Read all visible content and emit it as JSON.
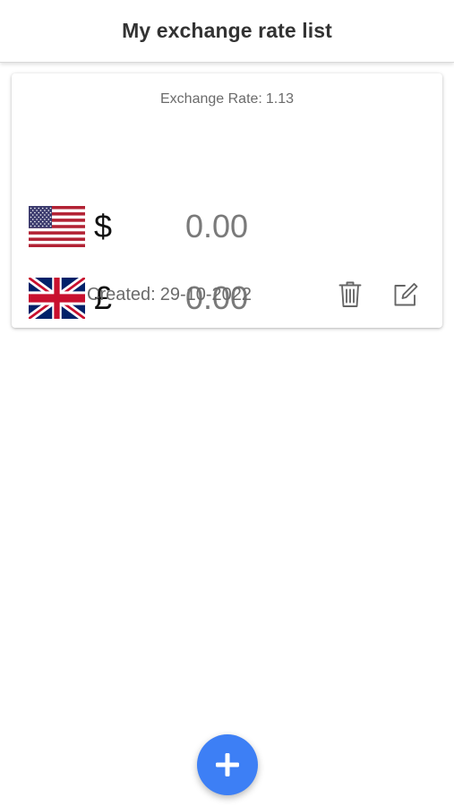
{
  "header": {
    "title": "My exchange rate list"
  },
  "card": {
    "rate_label": "Exchange Rate:",
    "rate_value": "1.13",
    "rows": [
      {
        "flag": "us-flag-icon",
        "symbol": "$",
        "amount": "0.00"
      },
      {
        "flag": "uk-flag-icon",
        "symbol": "£",
        "amount": "0.00"
      }
    ],
    "created_label": "Created:",
    "created_date": "29-10-2022",
    "delete_icon": "trash-icon",
    "edit_icon": "edit-icon"
  },
  "fab": {
    "icon": "plus-icon"
  },
  "colors": {
    "accent": "#3d7ff5",
    "muted_text": "#6b6b6b",
    "amount_text": "#7a7a7a"
  }
}
